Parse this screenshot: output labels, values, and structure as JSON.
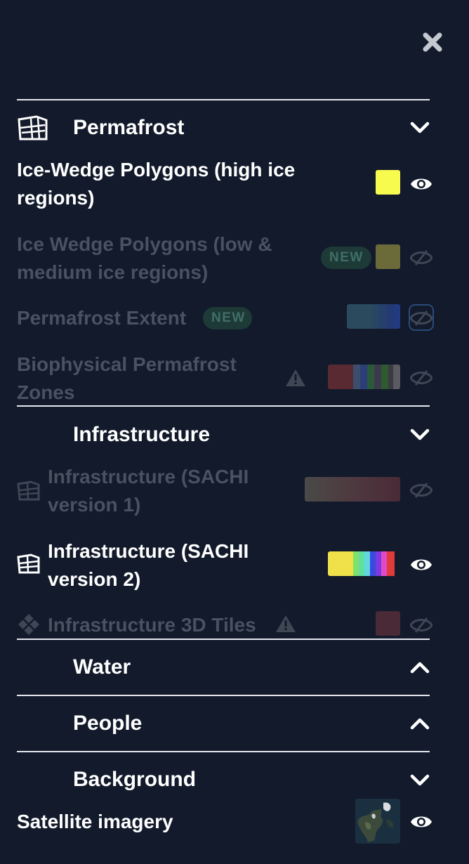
{
  "panel": {
    "close_icon": "close-icon",
    "sections": {
      "permafrost": {
        "title": "Permafrost",
        "icon": "permafrost-layers-icon",
        "chevron": "chevron-down-icon"
      },
      "infrastructure": {
        "title": "Infrastructure",
        "chevron": "chevron-down-icon"
      },
      "water": {
        "title": "Water",
        "chevron": "chevron-up-icon"
      },
      "people": {
        "title": "People",
        "chevron": "chevron-up-icon"
      },
      "background": {
        "title": "Background",
        "chevron": "chevron-down-icon"
      }
    },
    "layers": {
      "ice_wedge_high": {
        "name_line1": "Ice-Wedge Polygons (high ice",
        "name_line2": "regions)",
        "visible": true,
        "swatch": "#f7fb4e"
      },
      "ice_wedge_low": {
        "name_line1": "Ice Wedge Polygons (low &",
        "name_line2": "medium ice regions)",
        "badge": "NEW",
        "visible": false,
        "swatch": "#6b6b3a"
      },
      "permafrost_extent": {
        "name": "Permafrost Extent",
        "badge": "NEW",
        "visible": false,
        "swatch_colors": [
          "#2c4a5e",
          "#2a4260",
          "#27406a",
          "#243a72",
          "#223a80"
        ]
      },
      "biophysical": {
        "name_line1": "Biophysical Permafrost",
        "name_line2": "Zones",
        "warning": true,
        "visible": false,
        "swatch_colors": [
          "#5a2a33",
          "#5a2a33",
          "#3c4d6d",
          "#2c3e7a",
          "#2a5a3a",
          "#3a3a4a",
          "#2f5a2f",
          "#3a3a44",
          "#5a5a60"
        ]
      },
      "infra_v1": {
        "name_line1": "Infrastructure (SACHI",
        "name_line2": "version 1)",
        "visible": false,
        "swatch_colors": [
          "#4a4a48",
          "#4e3940",
          "#4a2a36"
        ]
      },
      "infra_v2": {
        "name_line1": "Infrastructure (SACHI",
        "name_line2": "version 2)",
        "visible": true,
        "swatch_colors": [
          "#f0e04a",
          "#f0e04a",
          "#f0e04a",
          "#7fe06a",
          "#5fe0a0",
          "#5fd8e0",
          "#3a4adf",
          "#7a3adf",
          "#e04ac8",
          "#e03a3a"
        ]
      },
      "infra_3d": {
        "name": "Infrastructure 3D Tiles",
        "warning": true,
        "visible": false,
        "swatch": "#4a2a36"
      },
      "satellite": {
        "name": "Satellite imagery",
        "visible": true,
        "thumbnail": "satellite-thumbnail"
      }
    }
  }
}
